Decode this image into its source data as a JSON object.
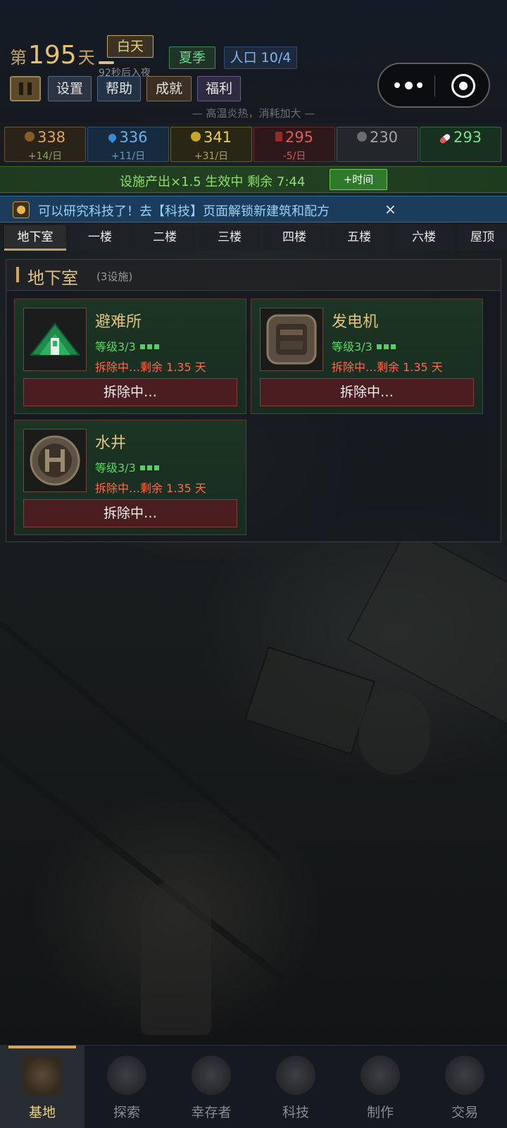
{
  "header": {
    "day_prefix": "第",
    "day_number": "195",
    "day_suffix": "天",
    "daytime": "白天",
    "night_countdown": "92秒后入夜",
    "season": "夏季",
    "population": "人口 10/4",
    "buttons": {
      "settings": "设置",
      "help": "帮助",
      "achievements": "成就",
      "welfare": "福利"
    },
    "heat_notice": "— 高温炎热，消耗加大 —"
  },
  "resources": [
    {
      "value": "338",
      "delta": "+14/日",
      "icon": "food-icon",
      "color": "#e0a45a",
      "delta_color": "#8ba26a"
    },
    {
      "value": "336",
      "delta": "+11/日",
      "icon": "water-drop-icon",
      "color": "#6cb0ee",
      "delta_color": "#6a9ac0"
    },
    {
      "value": "341",
      "delta": "+31/日",
      "icon": "lightning-icon",
      "color": "#eed34a",
      "delta_color": "#a8a26a"
    },
    {
      "value": "295",
      "delta": "-5/日",
      "icon": "medicine-icon",
      "color": "#e05a5a",
      "delta_color": "#d05a5a"
    },
    {
      "value": "230",
      "delta": "",
      "icon": "gear-icon",
      "color": "#a0a4a8",
      "delta_color": "#a0a4a8"
    },
    {
      "value": "293",
      "delta": "",
      "icon": "pill-icon",
      "color": "#7ee08a",
      "delta_color": "#7ee08a"
    }
  ],
  "bonus": {
    "text": "设施产出×1.5 生效中  剩余 7:44",
    "add_time": "+时间"
  },
  "notice": {
    "text": "可以研究科技了！去【科技】页面解锁新建筑和配方",
    "close": "×"
  },
  "tabs": [
    "地下室",
    "一楼",
    "二楼",
    "三楼",
    "四楼",
    "五楼",
    "六楼",
    "屋顶"
  ],
  "active_tab": "地下室",
  "panel": {
    "title": "地下室",
    "count": "(3设施)"
  },
  "facilities": [
    {
      "name": "避难所",
      "level": "等级3/3",
      "status": "拆除中…剩余 1.35 天",
      "action": "拆除中…",
      "icon": "shelter-icon"
    },
    {
      "name": "发电机",
      "level": "等级3/3",
      "status": "拆除中…剩余 1.35 天",
      "action": "拆除中…",
      "icon": "generator-icon"
    },
    {
      "name": "水井",
      "level": "等级3/3",
      "status": "拆除中…剩余 1.35 天",
      "action": "拆除中…",
      "icon": "well-icon"
    }
  ],
  "nav": [
    {
      "label": "基地",
      "icon": "base-icon"
    },
    {
      "label": "探索",
      "icon": "compass-icon"
    },
    {
      "label": "幸存者",
      "icon": "survivors-icon"
    },
    {
      "label": "科技",
      "icon": "tech-gear-icon"
    },
    {
      "label": "制作",
      "icon": "crafting-icon"
    },
    {
      "label": "交易",
      "icon": "trade-icon"
    }
  ]
}
